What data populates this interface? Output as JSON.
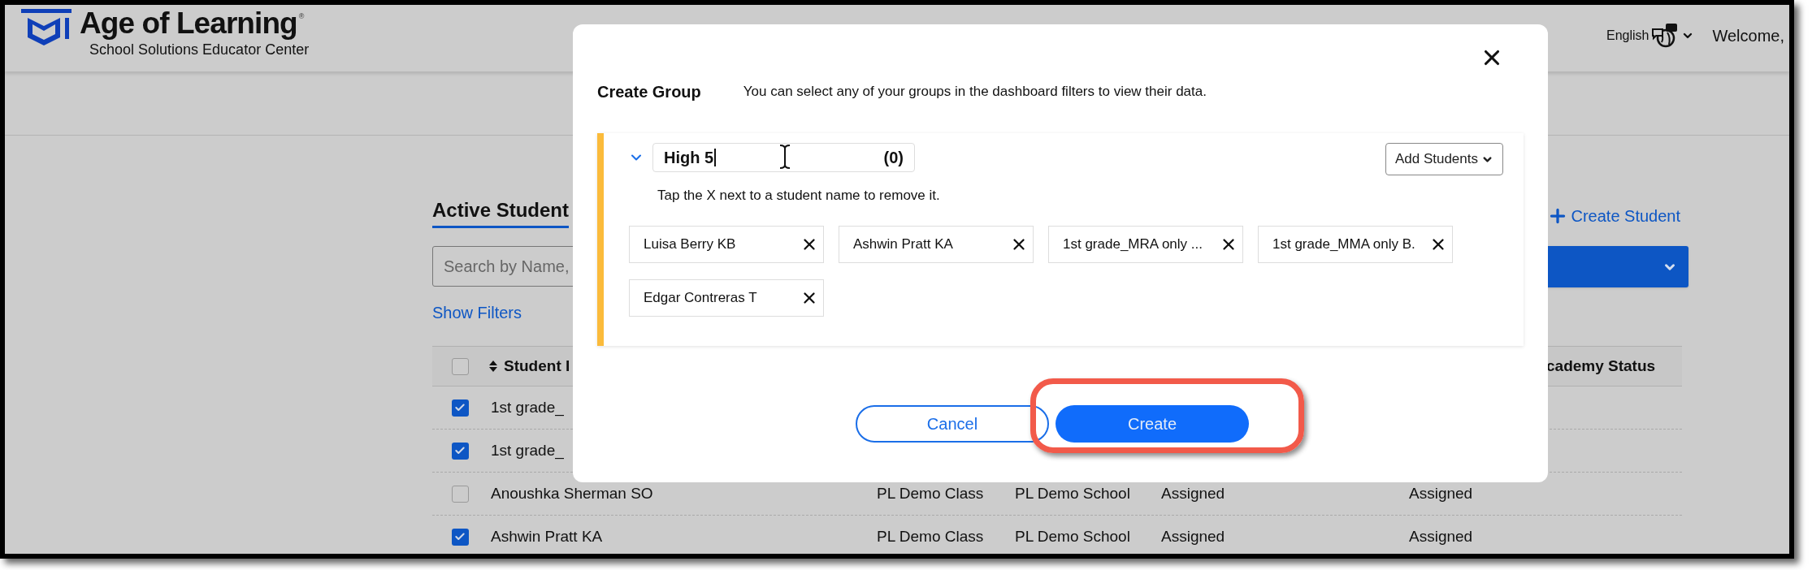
{
  "header": {
    "brand": "Age of Learning",
    "registered": "®",
    "subtitle": "School Solutions Educator Center",
    "language": "English",
    "welcome": "Welcome,"
  },
  "page": {
    "title": "Active Student",
    "search_placeholder": "Search by Name,",
    "show_filters": "Show Filters",
    "create_student": "Create Student"
  },
  "table": {
    "header_checked": false,
    "columns": [
      "Student I",
      "cademy Status"
    ],
    "rows": [
      {
        "checked": true,
        "cells": [
          "1st grade_"
        ]
      },
      {
        "checked": true,
        "cells": [
          "1st grade_"
        ]
      },
      {
        "checked": false,
        "cells": [
          "Anoushka Sherman SO",
          "PL Demo Class",
          "PL Demo School",
          "Assigned",
          "Assigned"
        ]
      },
      {
        "checked": true,
        "cells": [
          "Ashwin Pratt KA",
          "PL Demo Class",
          "PL Demo School",
          "Assigned",
          "Assigned"
        ]
      }
    ]
  },
  "modal": {
    "title": "Create Group",
    "description": "You can select any of your groups in the dashboard filters to view their data.",
    "group": {
      "expanded": true,
      "name": "High 5",
      "count": "(0)",
      "add_students": "Add Students",
      "hint": "Tap the X next to a student name to remove it.",
      "students": [
        "Luisa Berry KB",
        "Ashwin Pratt KA",
        "1st grade_MRA only ...",
        "1st grade_MMA only B.",
        "Edgar Contreras T"
      ]
    },
    "cancel": "Cancel",
    "create": "Create"
  }
}
